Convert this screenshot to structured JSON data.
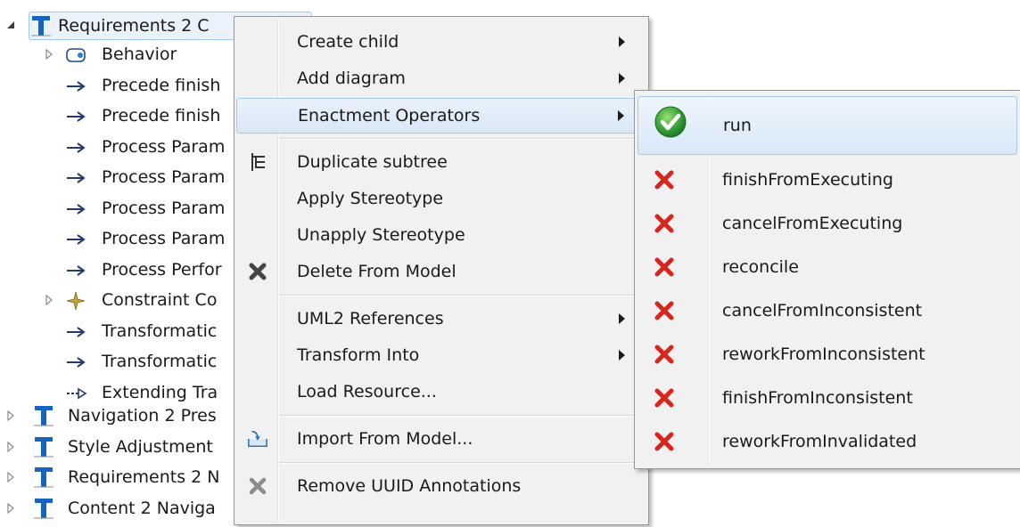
{
  "tree": {
    "root": {
      "label": "Requirements 2 C"
    },
    "children": [
      {
        "label": "Behavior",
        "icon": "behavior-icon",
        "expandable": true
      },
      {
        "label": "Precede finish",
        "icon": "arrow-icon"
      },
      {
        "label": "Precede finish",
        "icon": "arrow-icon"
      },
      {
        "label": "Process Param",
        "icon": "arrow-icon"
      },
      {
        "label": "Process Param",
        "icon": "arrow-icon"
      },
      {
        "label": "Process Param",
        "icon": "arrow-icon"
      },
      {
        "label": "Process Param",
        "icon": "arrow-icon"
      },
      {
        "label": "Process Perfor",
        "icon": "arrow-icon"
      },
      {
        "label": "Constraint Co",
        "icon": "constraint-icon",
        "expandable": true
      },
      {
        "label": "Transformatic",
        "icon": "arrow-icon"
      },
      {
        "label": "Transformatic",
        "icon": "arrow-icon"
      },
      {
        "label": "Extending Tra",
        "icon": "dashed-arrow-icon"
      }
    ],
    "siblings": [
      {
        "label": "Navigation 2 Pres"
      },
      {
        "label": "Style Adjustment"
      },
      {
        "label": "Requirements 2 N"
      },
      {
        "label": "Content 2 Naviga"
      }
    ]
  },
  "context_menu": {
    "groups": [
      [
        {
          "label": "Create child",
          "submenu": true
        },
        {
          "label": "Add diagram",
          "submenu": true
        },
        {
          "label": "Enactment Operators",
          "submenu": true,
          "active": true
        }
      ],
      [
        {
          "label": "Duplicate subtree",
          "icon": "duplicate-subtree-icon"
        },
        {
          "label": "Apply Stereotype"
        },
        {
          "label": "Unapply Stereotype"
        },
        {
          "label": "Delete From Model",
          "icon": "delete-icon"
        }
      ],
      [
        {
          "label": "UML2 References",
          "submenu": true
        },
        {
          "label": "Transform Into",
          "submenu": true
        },
        {
          "label": "Load Resource..."
        }
      ],
      [
        {
          "label": "Import From Model...",
          "icon": "import-icon"
        }
      ],
      [
        {
          "label": "Remove UUID Annotations",
          "icon": "remove-icon"
        }
      ]
    ]
  },
  "submenu": {
    "items": [
      {
        "label": "run",
        "icon": "check-icon",
        "enabled": true
      },
      {
        "label": "finishFromExecuting",
        "icon": "x-icon"
      },
      {
        "label": "cancelFromExecuting",
        "icon": "x-icon"
      },
      {
        "label": "reconcile",
        "icon": "x-icon"
      },
      {
        "label": "cancelFromInconsistent",
        "icon": "x-icon"
      },
      {
        "label": "reworkFromInconsistent",
        "icon": "x-icon"
      },
      {
        "label": "finishFromInconsistent",
        "icon": "x-icon"
      },
      {
        "label": "reworkFromInvalidated",
        "icon": "x-icon"
      }
    ]
  },
  "colors": {
    "tree_t_icon": "#1565c0",
    "arrow": "#223a6e",
    "check_green": "#3aa63a",
    "x_red": "#d8261c",
    "menu_bg": "#f1f1f1",
    "highlight_border": "#a8c9ec"
  }
}
